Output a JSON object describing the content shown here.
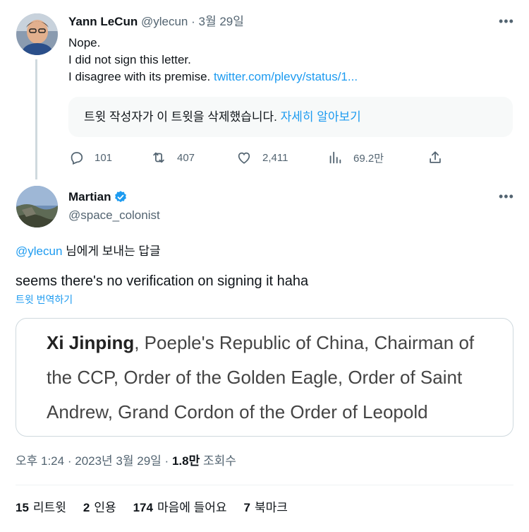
{
  "parent_tweet": {
    "name": "Yann LeCun",
    "handle": "@ylecun",
    "separator": "·",
    "date": "3월 29일",
    "lines": [
      "Nope.",
      "I did not sign this letter."
    ],
    "line3_text": "I disagree with its premise.",
    "line3_link": "twitter.com/plevy/status/1...",
    "quote_removed_text": "트윗 작성자가 이 트윗을 삭제했습니다.",
    "quote_removed_link": "자세히 알아보기",
    "actions": {
      "replies": "101",
      "retweets": "407",
      "likes": "2,411",
      "views": "69.2만"
    },
    "more_icon": "more-horizontal-icon"
  },
  "reply_tweet": {
    "name": "Martian",
    "verified": true,
    "handle": "@space_colonist",
    "reply_to_mention": "@ylecun",
    "reply_to_suffix": " 님에게 보내는 답글",
    "text": "seems there's no verification on signing it haha",
    "translate": "트윗 번역하기",
    "card": {
      "bold_name": "Xi Jinping",
      "rest": ", Poeple's Republic of China, Chairman of the CCP, Order of the Golden Eagle, Order of Saint Andrew, Grand Cordon of the Order of Leopold"
    },
    "meta": {
      "time": "오후 1:24",
      "date": "2023년 3월 29일",
      "views_num": "1.8만",
      "views_label": "조회수"
    },
    "stats": [
      {
        "num": "15",
        "label": "리트윗"
      },
      {
        "num": "2",
        "label": "인용"
      },
      {
        "num": "174",
        "label": "마음에 들어요"
      },
      {
        "num": "7",
        "label": "북마크"
      }
    ]
  },
  "colors": {
    "accent": "#1d9bf0",
    "muted": "#536471",
    "border": "#cfd9de",
    "text": "#0f1419"
  }
}
